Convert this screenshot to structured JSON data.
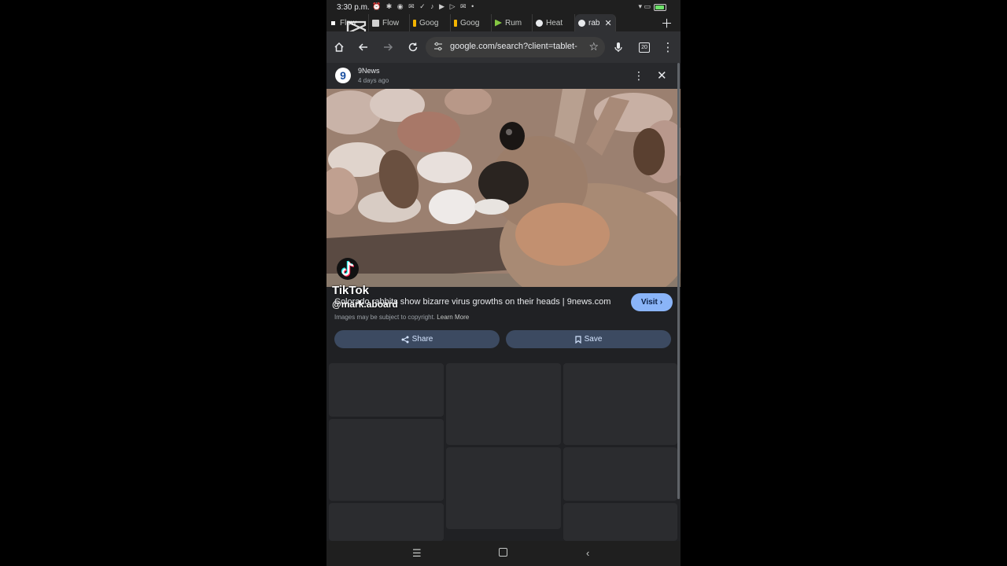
{
  "status_bar": {
    "time": "3:30 p.m.",
    "notification_icons": "⏰ ✱ ◉ ✉ ✓ ♪ ▶ ▷ ✉ •",
    "right_icons": "▾ ▭"
  },
  "tabs": [
    {
      "label": "Flow",
      "favicon_color": "#ffffff"
    },
    {
      "label": "Flow",
      "favicon_color": "#d0d0d0"
    },
    {
      "label": "Goog",
      "favicon_color": "#f4b400"
    },
    {
      "label": "Goog",
      "favicon_color": "#f4b400"
    },
    {
      "label": "Rum",
      "favicon_color": "#85c742"
    },
    {
      "label": "Heat",
      "favicon_color": "#e8eaed"
    },
    {
      "label": "rab",
      "favicon_color": "#e8eaed",
      "active": true
    }
  ],
  "toolbar": {
    "url": "google.com/search?client=tablet-a",
    "tab_count": "20"
  },
  "source": {
    "logo_text": "9",
    "name": "9News",
    "time": "4 days ago"
  },
  "overlay": {
    "tiktok": "TikTok",
    "username": "@mark.aboard"
  },
  "result": {
    "title": "Colorado rabbits show bizarre virus growths on their heads | 9news.com",
    "visit_label": "Visit",
    "copyright_text": "Images may be subject to copyright.",
    "learn_more": "Learn More",
    "share_label": "Share",
    "save_label": "Save"
  },
  "colors": {
    "accent": "#8ab4f8",
    "button_bg": "#3c4a61",
    "page_bg": "#202124"
  }
}
